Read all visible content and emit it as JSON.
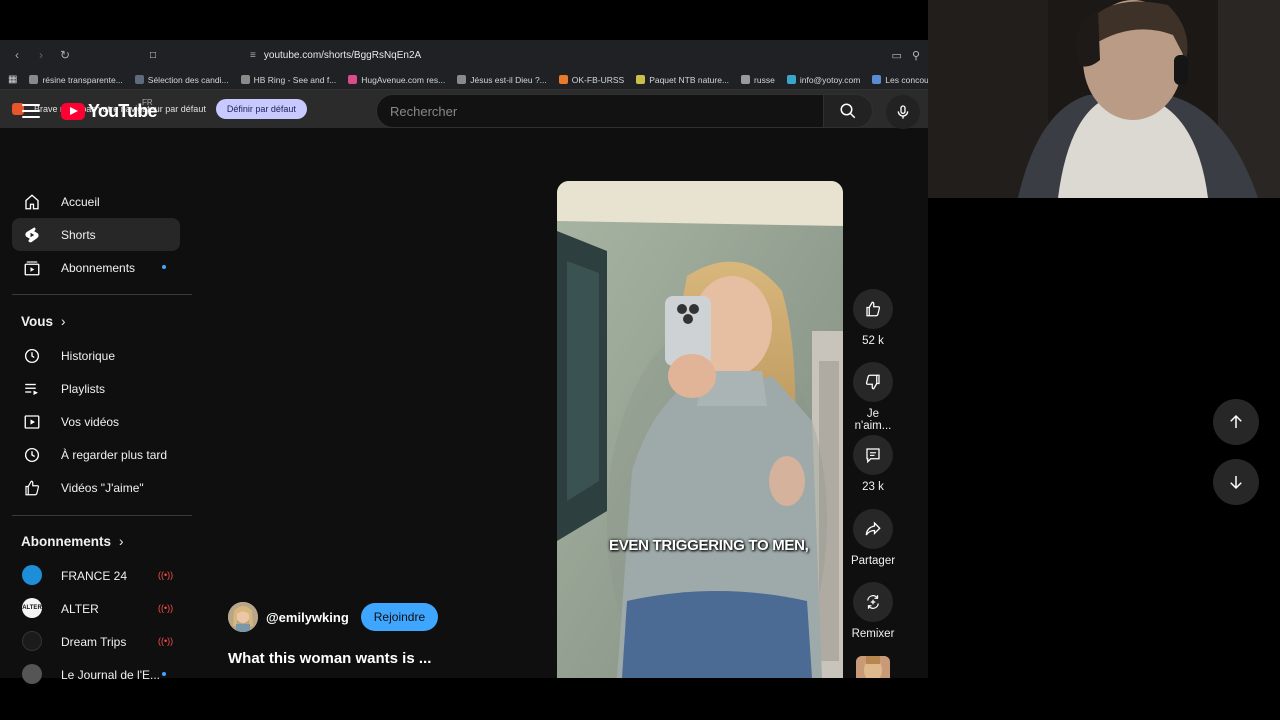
{
  "browser": {
    "url": "youtube.com/shorts/BggRsNqEn2A",
    "bookmarks": [
      {
        "label": "résine transparente...",
        "color": "#8a8a8a"
      },
      {
        "label": "Sélection des candi...",
        "color": "#5f6b7a"
      },
      {
        "label": "HB Ring - See and f...",
        "color": "#8a8a8a"
      },
      {
        "label": "HugAvenue.com res...",
        "color": "#d94c8a"
      },
      {
        "label": "Jésus est-il Dieu ?...",
        "color": "#8a8a8a"
      },
      {
        "label": "OK-FB-URSS",
        "color": "#e87a2a"
      },
      {
        "label": "Paquet NTB nature...",
        "color": "#c9c04a"
      },
      {
        "label": "russe",
        "color": "#9a9a9a"
      },
      {
        "label": "info@yotoy.com",
        "color": "#3aa6c9"
      },
      {
        "label": "Les concours d'a",
        "color": "#5b8bd0"
      }
    ],
    "notice_text": "Brave n'est pas votre navigateur par défaut",
    "notice_button": "Définir par défaut"
  },
  "header": {
    "logo_text": "YouTube",
    "logo_region": "FR",
    "search_placeholder": "Rechercher"
  },
  "sidebar": {
    "main": [
      {
        "label": "Accueil",
        "icon": "home-icon"
      },
      {
        "label": "Shorts",
        "icon": "shorts-icon"
      },
      {
        "label": "Abonnements",
        "icon": "subscriptions-icon"
      }
    ],
    "you_header": "Vous",
    "you_items": [
      {
        "label": "Historique",
        "icon": "history-icon"
      },
      {
        "label": "Playlists",
        "icon": "playlists-icon"
      },
      {
        "label": "Vos vidéos",
        "icon": "your-videos-icon"
      },
      {
        "label": "À regarder plus tard",
        "icon": "watch-later-icon"
      },
      {
        "label": "Vidéos \"J'aime\"",
        "icon": "liked-videos-icon"
      }
    ],
    "subs_header": "Abonnements",
    "subscriptions": [
      {
        "label": "FRANCE 24",
        "avatar_color": "#1f8ed8",
        "avatar_text": ""
      },
      {
        "label": "ALTER",
        "avatar_color": "#f5f5f5",
        "avatar_text": "ALTER"
      },
      {
        "label": "Dream Trips",
        "avatar_color": "#1b1b1b",
        "avatar_text": ""
      },
      {
        "label": "Le Journal de l'E...",
        "avatar_color": "#555555",
        "avatar_text": ""
      }
    ]
  },
  "short": {
    "caption": "EVEN TRIGGERING TO MEN,",
    "channel": "@emilywking",
    "join_label": "Rejoindre",
    "title": "What this woman wants is ..."
  },
  "actions": {
    "likes": "52 k",
    "dislike_label": "Je n'aim...",
    "comments": "23 k",
    "share_label": "Partager",
    "remix_label": "Remixer"
  }
}
